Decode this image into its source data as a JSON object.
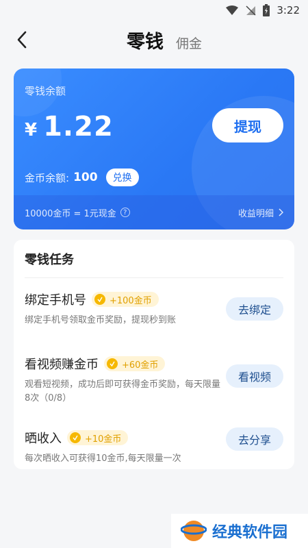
{
  "status": {
    "time": "3:22"
  },
  "header": {
    "active_tab": "零钱",
    "other_tab": "佣金"
  },
  "balance_card": {
    "title": "零钱余额",
    "currency": "¥",
    "amount": "1.22",
    "withdraw_label": "提现",
    "coin_label": "金币余额:",
    "coin_value": "100",
    "exchange_label": "兑换",
    "rate_text": "10000金币 = 1元现金",
    "detail_link": "收益明细"
  },
  "tasks": {
    "title": "零钱任务",
    "items": [
      {
        "name": "绑定手机号",
        "reward": "+100金币",
        "desc": "绑定手机号领取金币奖励，提现秒到账",
        "button": "去绑定"
      },
      {
        "name": "看视频赚金币",
        "reward": "+60金币",
        "desc": "观看短视频，成功后即可获得金币奖励，每天限量8次（0/8）",
        "button": "看视频"
      },
      {
        "name": "晒收入",
        "reward": "+10金币",
        "desc": "每次晒收入可获得10金币,每天限量一次",
        "button": "去分享"
      }
    ]
  },
  "watermark": {
    "text": "经典软件园"
  },
  "colors": {
    "accent": "#2a78f5",
    "coin": "#f6b800"
  }
}
